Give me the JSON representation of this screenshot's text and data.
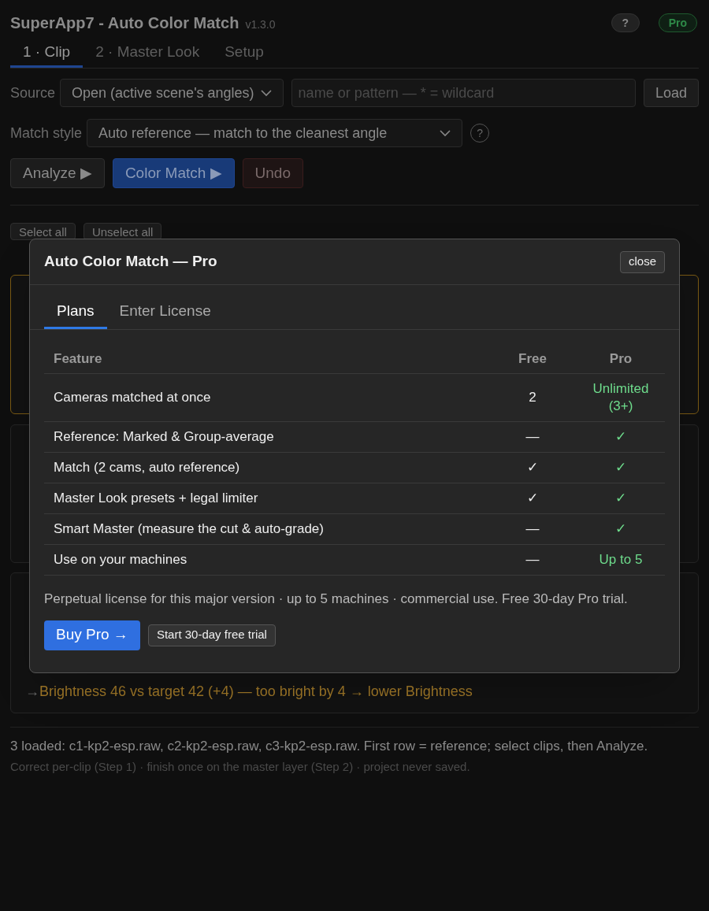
{
  "app": {
    "title": "SuperApp7 - Auto Color Match",
    "version": "v1.3.0",
    "help": "?",
    "badge": "Pro"
  },
  "tabs": [
    {
      "label": "1 · Clip",
      "selected": true
    },
    {
      "label": "2 · Master Look",
      "selected": false
    },
    {
      "label": "Setup",
      "selected": false
    }
  ],
  "source": {
    "label": "Source",
    "value": "Open (active scene's angles)",
    "placeholder": "name or pattern — * = wildcard",
    "button": "Load"
  },
  "match_style": {
    "label": "Match style",
    "value": "Auto reference — match to the cleanest angle",
    "help": "?"
  },
  "actions": [
    {
      "label": "Analyze ▶",
      "kind": "neutral"
    },
    {
      "label": "Color Match ▶",
      "kind": "primary"
    },
    {
      "label": "Undo",
      "kind": "danger"
    }
  ],
  "selection_buttons": [
    "Select all",
    "Unselect all"
  ],
  "clip_cards": [
    {
      "highlighted": true
    },
    {
      "highlighted": false
    },
    {
      "highlighted": false,
      "marker": "→",
      "note": "Brightness 46 vs target 42 (+4) — too bright by 4 → lower Brightness"
    }
  ],
  "status": {
    "summary": "3 loaded: c1-kp2-esp.raw, c2-kp2-esp.raw, c3-kp2-esp.raw. First row = reference; select clips, then Analyze.",
    "hint": "Correct per-clip (Step 1) · finish once on the master layer (Step 2) · project never saved."
  },
  "dialog": {
    "title": "Auto Color Match — Pro",
    "close": "close",
    "tabs": [
      {
        "label": "Plans",
        "selected": true
      },
      {
        "label": "Enter License",
        "selected": false
      }
    ],
    "columns": [
      "Feature",
      "Free",
      "Pro"
    ],
    "rows": [
      {
        "feature": "Cameras matched at once",
        "free": "2",
        "pro": "Unlimited (3+)"
      },
      {
        "feature": "Reference: Marked & Group-average",
        "free": "—",
        "pro": "✓"
      },
      {
        "feature": "Match (2 cams, auto reference)",
        "free": "✓",
        "pro": "✓"
      },
      {
        "feature": "Master Look presets + legal limiter",
        "free": "✓",
        "pro": "✓"
      },
      {
        "feature": "Smart Master (measure the cut & auto-grade)",
        "free": "—",
        "pro": "✓"
      },
      {
        "feature": "Use on your machines",
        "free": "—",
        "pro": "Up to 5"
      }
    ],
    "footnote": "Perpetual license for this major version · up to 5 machines · commercial use. Free 30-day Pro trial.",
    "buttons": [
      {
        "label": "Buy Pro →",
        "kind": "primary"
      },
      {
        "label": "Start 30-day free trial",
        "kind": "secondary"
      }
    ]
  }
}
